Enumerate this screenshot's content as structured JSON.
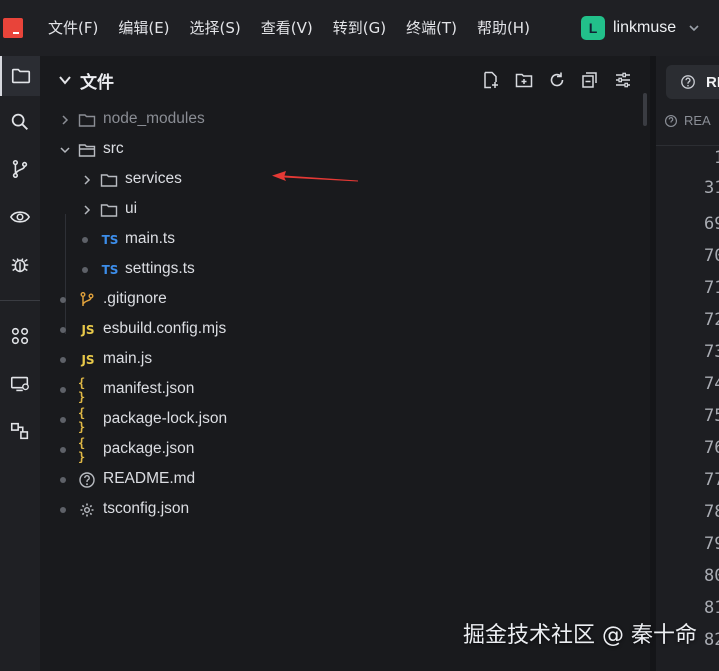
{
  "menubar": {
    "items": [
      "文件(F)",
      "编辑(E)",
      "选择(S)",
      "查看(V)",
      "转到(G)",
      "终端(T)",
      "帮助(H)"
    ],
    "workspace": {
      "initial": "L",
      "name": "linkmuse",
      "color": "#22c08a"
    }
  },
  "explorer": {
    "title": "文件",
    "tree": [
      {
        "name": "node_modules",
        "kind": "folder",
        "expanded": false,
        "dim": true
      },
      {
        "name": "src",
        "kind": "folder",
        "expanded": true
      },
      {
        "name": "services",
        "kind": "folder",
        "expanded": false
      },
      {
        "name": "ui",
        "kind": "folder",
        "expanded": false
      },
      {
        "name": "main.ts",
        "kind": "ts",
        "badge": "TS"
      },
      {
        "name": "settings.ts",
        "kind": "ts",
        "badge": "TS"
      },
      {
        "name": ".gitignore",
        "kind": "git"
      },
      {
        "name": "esbuild.config.mjs",
        "kind": "js",
        "badge": "JS"
      },
      {
        "name": "main.js",
        "kind": "js",
        "badge": "JS"
      },
      {
        "name": "manifest.json",
        "kind": "json",
        "badge": "{ }"
      },
      {
        "name": "package-lock.json",
        "kind": "json",
        "badge": "{ }"
      },
      {
        "name": "package.json",
        "kind": "json",
        "badge": "{ }"
      },
      {
        "name": "README.md",
        "kind": "readme"
      },
      {
        "name": "tsconfig.json",
        "kind": "config"
      }
    ]
  },
  "editor": {
    "tab_label": "RI",
    "breadcrumb": "REA",
    "line_numbers": [
      "1",
      "31",
      "69",
      "70",
      "71",
      "72",
      "73",
      "74",
      "75",
      "76",
      "77",
      "78",
      "79",
      "80",
      "81",
      "82"
    ]
  },
  "watermark": "掘金技术社区 @ 秦十命",
  "colors": {
    "accent": "#e8443a",
    "ts": "#3c8dea",
    "js": "#e8c94a",
    "arrow": "#e53935"
  }
}
